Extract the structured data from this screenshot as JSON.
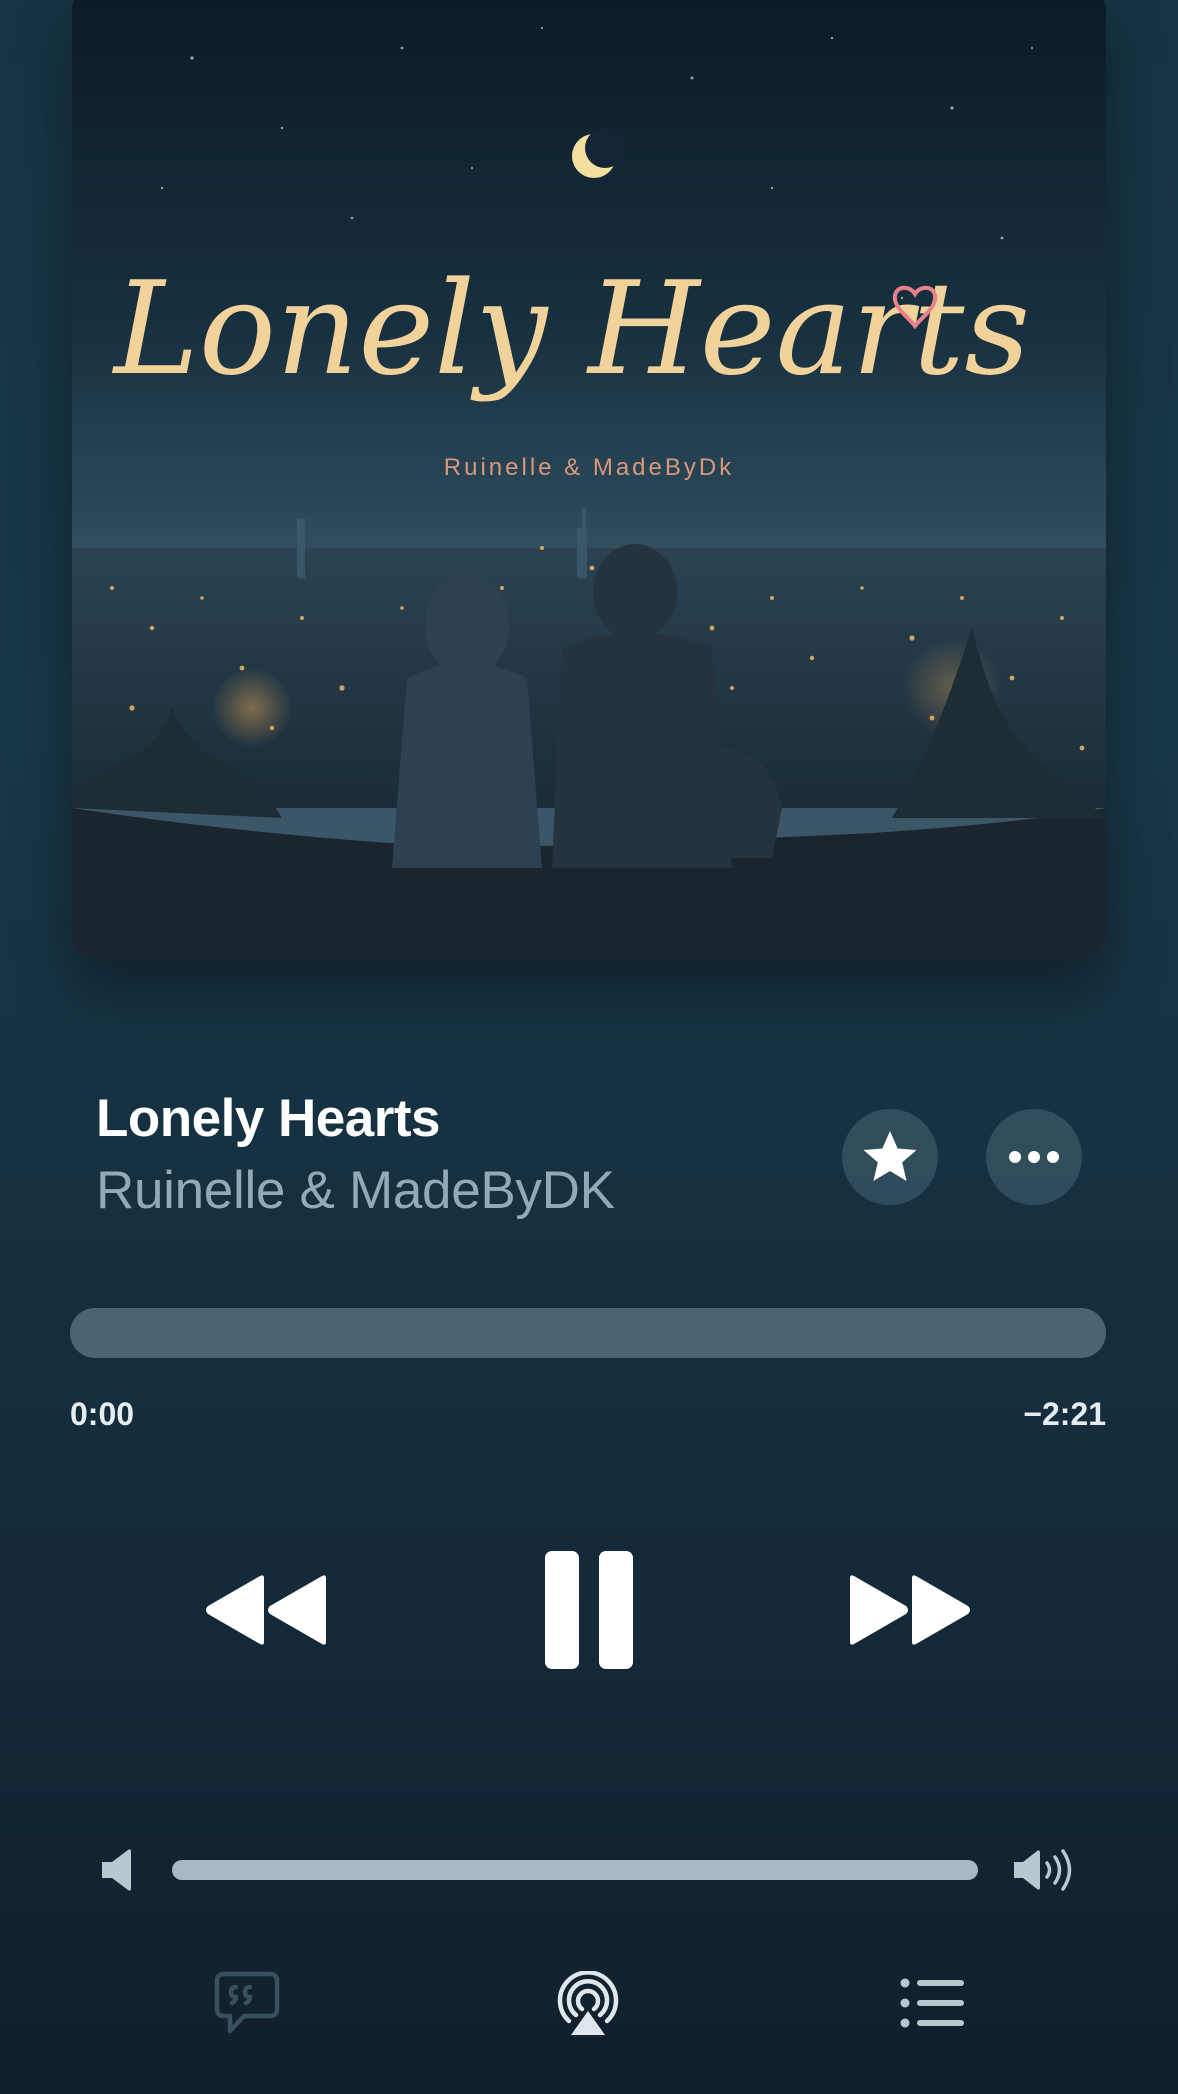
{
  "artwork": {
    "title_script": "Lonely Hearts",
    "artist_text": "Ruinelle & MadeByDk"
  },
  "track": {
    "title": "Lonely Hearts",
    "artist": "Ruinelle & MadeByDK"
  },
  "actions": {
    "favorite_icon": "star-icon",
    "more_icon": "ellipsis-icon"
  },
  "progress": {
    "elapsed": "0:00",
    "remaining": "−2:21",
    "fraction": 0.0
  },
  "transport": {
    "rewind_icon": "rewind-icon",
    "pause_icon": "pause-icon",
    "forward_icon": "fast-forward-icon"
  },
  "volume": {
    "level": 1.0,
    "low_icon": "speaker-low-icon",
    "high_icon": "speaker-high-icon"
  },
  "bottom_bar": {
    "lyrics_icon": "lyrics-quote-icon",
    "airplay_icon": "airplay-icon",
    "queue_icon": "queue-list-icon"
  },
  "colors": {
    "background_top": "#163444",
    "background_bottom": "#111f2c",
    "title_text": "#ffffff",
    "artist_text": "#93a9b6",
    "track_bg": "#4b6472",
    "track_fill": "#a7b9c4",
    "art_script": "#f1d29a",
    "art_artist": "#d9987a",
    "art_heart": "#e8828a"
  }
}
